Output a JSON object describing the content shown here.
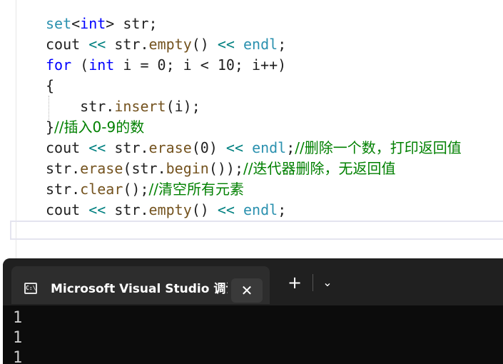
{
  "editor": {
    "lines": [
      [
        [
          "set",
          "ty"
        ],
        [
          "<",
          "pl"
        ],
        [
          "int",
          "kw"
        ],
        [
          "> ",
          "pl"
        ],
        [
          "str",
          "id"
        ],
        [
          ";",
          "pl"
        ]
      ],
      [
        [
          "cout ",
          "id"
        ],
        [
          "<<",
          "op"
        ],
        [
          " ",
          "pl"
        ],
        [
          "str",
          "id"
        ],
        [
          ".",
          "pl"
        ],
        [
          "empty",
          "fn"
        ],
        [
          "() ",
          "pl"
        ],
        [
          "<<",
          "op"
        ],
        [
          " ",
          "pl"
        ],
        [
          "endl",
          "ty"
        ],
        [
          ";",
          "pl"
        ]
      ],
      [
        [
          "for",
          "kw"
        ],
        [
          " (",
          "pl"
        ],
        [
          "int",
          "kw"
        ],
        [
          " i = 0; i < 10; i++)",
          "pl"
        ]
      ],
      [
        [
          "{",
          "pl"
        ]
      ],
      [
        [
          "    str",
          "id"
        ],
        [
          ".",
          "pl"
        ],
        [
          "insert",
          "fn"
        ],
        [
          "(i);",
          "pl"
        ]
      ],
      [
        [
          "}",
          "pl"
        ],
        [
          "//插入0-9的数",
          "cm"
        ]
      ],
      [
        [
          "cout ",
          "id"
        ],
        [
          "<<",
          "op"
        ],
        [
          " ",
          "pl"
        ],
        [
          "str",
          "id"
        ],
        [
          ".",
          "pl"
        ],
        [
          "erase",
          "fn"
        ],
        [
          "(0) ",
          "pl"
        ],
        [
          "<<",
          "op"
        ],
        [
          " ",
          "pl"
        ],
        [
          "endl",
          "ty"
        ],
        [
          ";",
          "pl"
        ],
        [
          "//删除一个数，打印返回值",
          "cm"
        ]
      ],
      [
        [
          "str",
          "id"
        ],
        [
          ".",
          "pl"
        ],
        [
          "erase",
          "fn"
        ],
        [
          "(",
          "pl"
        ],
        [
          "str",
          "id"
        ],
        [
          ".",
          "pl"
        ],
        [
          "begin",
          "fn"
        ],
        [
          "());",
          "pl"
        ],
        [
          "//迭代器删除，无返回值",
          "cm"
        ]
      ],
      [
        [
          "str",
          "id"
        ],
        [
          ".",
          "pl"
        ],
        [
          "clear",
          "fn"
        ],
        [
          "();",
          "pl"
        ],
        [
          "//清空所有元素",
          "cm"
        ]
      ],
      [
        [
          "cout ",
          "id"
        ],
        [
          "<<",
          "op"
        ],
        [
          " ",
          "pl"
        ],
        [
          "str",
          "id"
        ],
        [
          ".",
          "pl"
        ],
        [
          "empty",
          "fn"
        ],
        [
          "() ",
          "pl"
        ],
        [
          "<<",
          "op"
        ],
        [
          " ",
          "pl"
        ],
        [
          "endl",
          "ty"
        ],
        [
          ";",
          "pl"
        ]
      ]
    ]
  },
  "terminal": {
    "tab_icon": "console-icon",
    "tab_icon_glyph": "C:\\",
    "tab_title": "Microsoft Visual Studio 调试控制台",
    "close_glyph": "✕",
    "new_tab_glyph": "+",
    "dropdown_glyph": "⌄",
    "output_lines": [
      "1",
      "1",
      "1"
    ]
  }
}
